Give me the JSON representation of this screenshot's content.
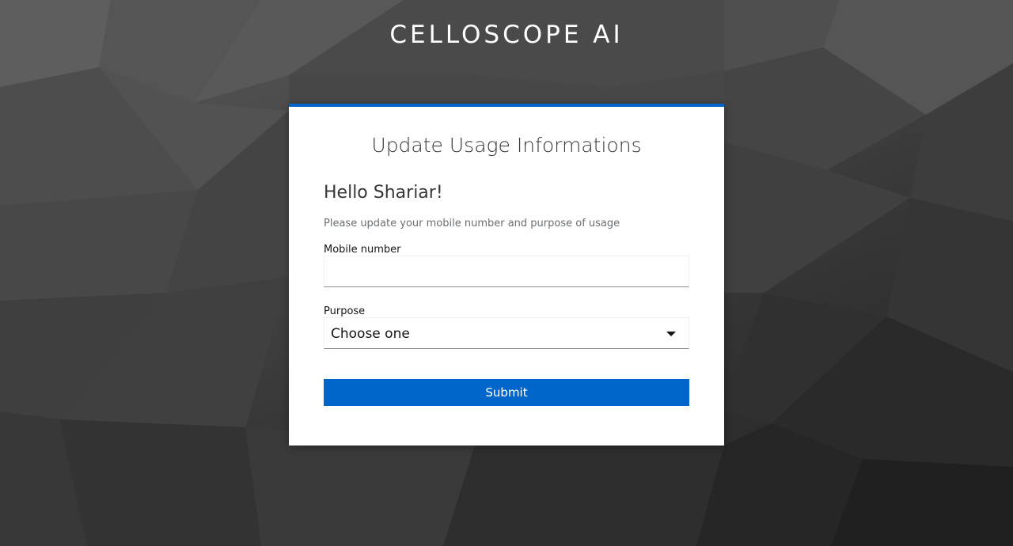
{
  "brand": {
    "title": "CELLOSCOPE AI"
  },
  "card": {
    "title": "Update Usage Informations",
    "greeting": "Hello Shariar!",
    "subtitle": "Please update your mobile number and purpose of usage",
    "accent_color": "#0066cc"
  },
  "form": {
    "mobile": {
      "label": "Mobile number",
      "value": "",
      "placeholder": ""
    },
    "purpose": {
      "label": "Purpose",
      "selected": "Choose one",
      "icon": "caret-down-icon"
    },
    "submit_label": "Submit"
  }
}
